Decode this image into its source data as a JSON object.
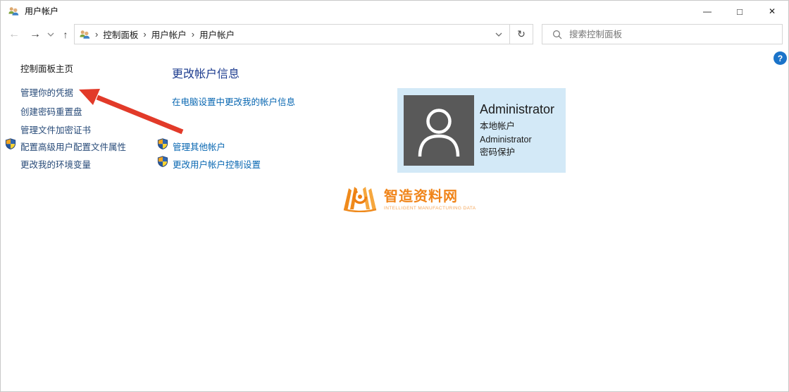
{
  "window": {
    "title": "用户帐户"
  },
  "titlebar": {
    "minimize_icon": "—",
    "maximize_icon": "□",
    "close_icon": "✕"
  },
  "navbar": {
    "back_icon": "←",
    "forward_icon": "→",
    "up_icon": "↑",
    "refresh_icon": "↻",
    "breadcrumb": {
      "separator": "›",
      "items": [
        {
          "label": "控制面板"
        },
        {
          "label": "用户帐户"
        },
        {
          "label": "用户帐户"
        }
      ]
    },
    "search": {
      "placeholder": "搜索控制面板"
    }
  },
  "sidebar": {
    "items": [
      {
        "label": "控制面板主页"
      },
      {
        "label": "管理你的凭据"
      },
      {
        "label": "创建密码重置盘"
      },
      {
        "label": "管理文件加密证书"
      },
      {
        "label": "配置高级用户配置文件属性",
        "shield": true
      },
      {
        "label": "更改我的环境变量"
      }
    ]
  },
  "main": {
    "heading": "更改帐户信息",
    "links": [
      {
        "label": "在电脑设置中更改我的帐户信息",
        "shield": false
      },
      {
        "label": "管理其他帐户",
        "shield": true
      },
      {
        "label": "更改用户帐户控制设置",
        "shield": true
      }
    ]
  },
  "user_panel": {
    "name": "Administrator",
    "details": [
      "本地帐户",
      "Administrator",
      "密码保护"
    ]
  },
  "watermark": {
    "title": "智造资料网",
    "subtitle": "INTELLIGENT MANUFACTURING DATA"
  },
  "help": {
    "label": "?"
  },
  "annotation": {
    "shape": "red-arrow",
    "target": "管理你的凭据"
  },
  "colors": {
    "content_link": "#0766b1",
    "sidebar_link": "#274a78",
    "heading": "#1d3c8f",
    "panel_bg": "#d3e9f7",
    "avatar_bg": "#595959",
    "arrow_red": "#e23a29",
    "logo_orange": "#f08419",
    "help_blue": "#1a73c9"
  }
}
